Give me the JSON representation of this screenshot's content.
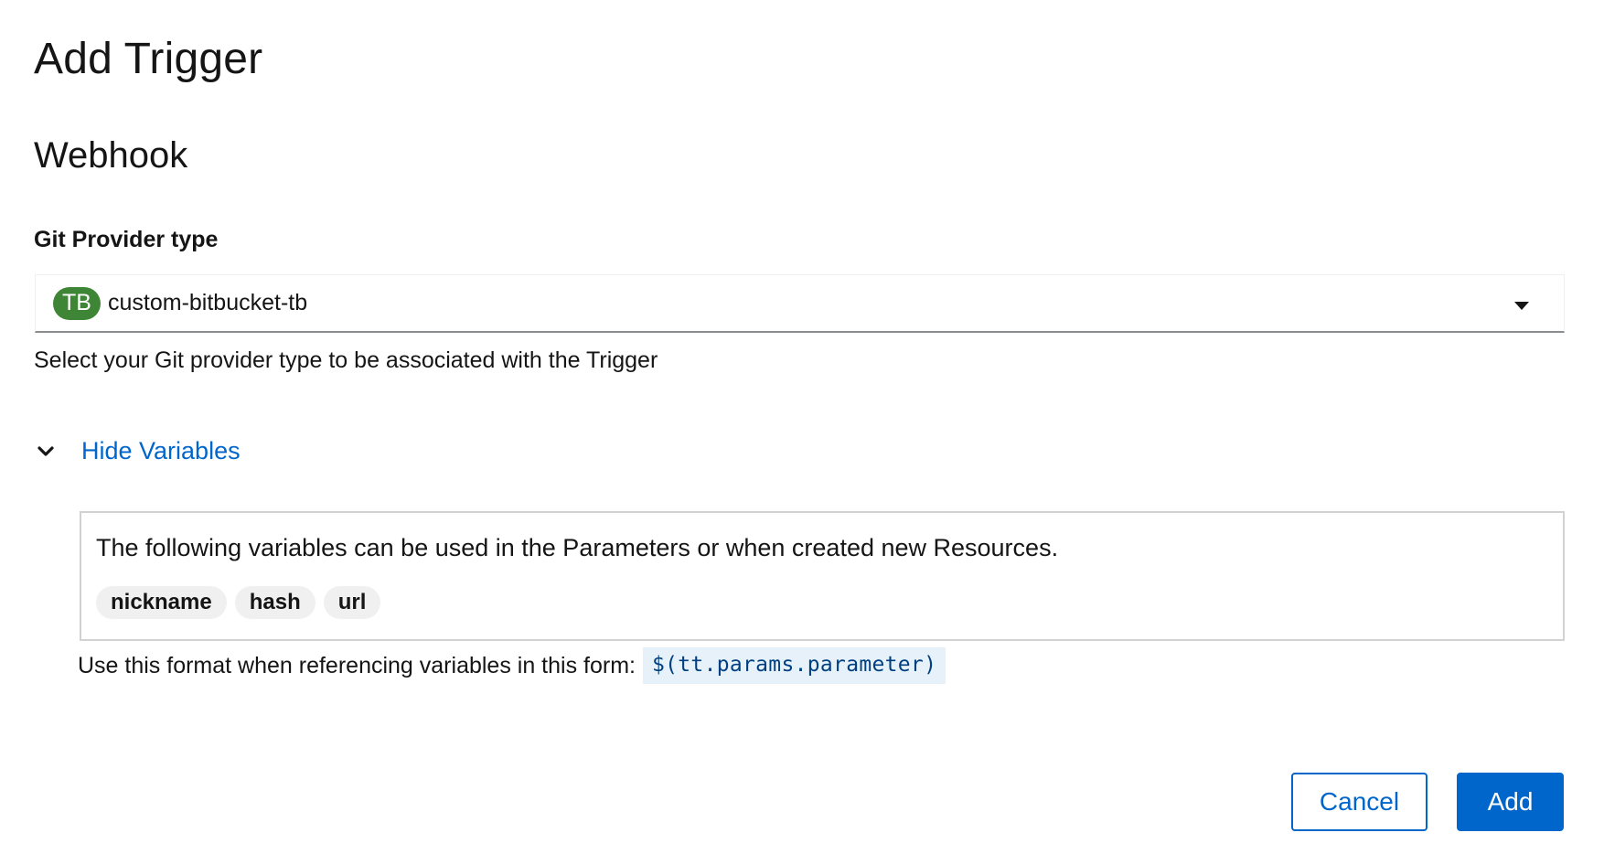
{
  "modal": {
    "title": "Add Trigger",
    "section_title": "Webhook"
  },
  "git_provider": {
    "label": "Git Provider type",
    "badge": "TB",
    "badge_color": "#3e8635",
    "selected_value": "custom-bitbucket-tb",
    "helper_text": "Select your Git provider type to be associated with the Trigger"
  },
  "variables": {
    "toggle_label": "Hide Variables",
    "toggle_icon": "chevron-down-icon",
    "description": "The following variables can be used in the Parameters or when created new Resources.",
    "chips": [
      "nickname",
      "hash",
      "url"
    ],
    "format_text": "Use this format when referencing variables in this form:",
    "format_code": "$(tt.params.parameter)"
  },
  "footer": {
    "cancel_label": "Cancel",
    "add_label": "Add",
    "accent_color": "#0066cc"
  }
}
